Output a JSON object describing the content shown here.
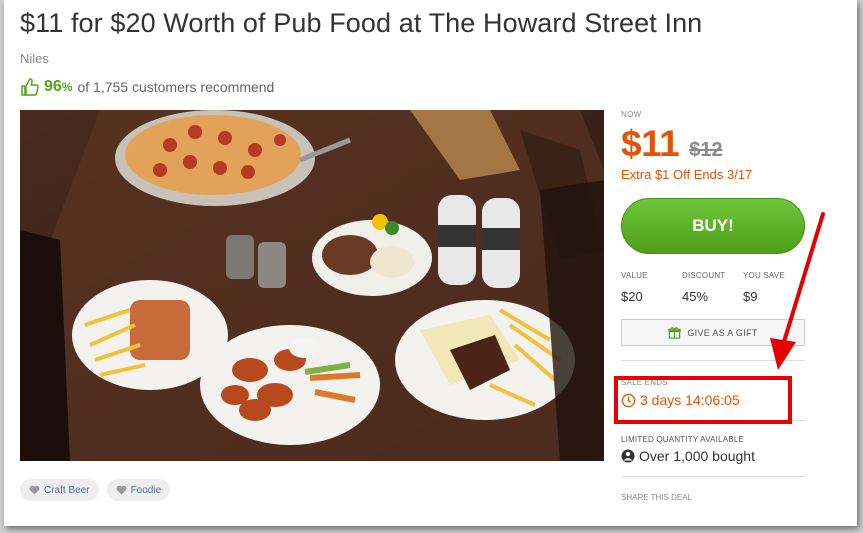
{
  "deal": {
    "title": "$11 for $20 Worth of Pub Food at The Howard Street Inn",
    "location": "Niles",
    "recommend_pct": "96",
    "recommend_pct_sign": "%",
    "recommend_text": "of 1,755 customers recommend"
  },
  "tags": [
    {
      "label": "Craft Beer",
      "icon": "heart-icon"
    },
    {
      "label": "Foodie",
      "icon": "heart-icon"
    }
  ],
  "pricing": {
    "now_label": "NOW",
    "price": "$11",
    "original_price": "$12",
    "promo": "Extra $1 Off Ends 3/17",
    "buy_label": "BUY!",
    "value_label": "VALUE",
    "value": "$20",
    "discount_label": "DISCOUNT",
    "discount": "45%",
    "you_save_label": "YOU SAVE",
    "you_save": "$9",
    "gift_label": "GIVE AS A GIFT"
  },
  "sale": {
    "label": "SALE ENDS",
    "countdown": "3 days 14:06:05"
  },
  "quantity": {
    "label": "LIMITED QUANTITY AVAILABLE",
    "bought": "Over 1,000 bought"
  },
  "share": {
    "label": "SHARE THIS DEAL"
  },
  "colors": {
    "accent_orange": "#e35205",
    "buy_green": "#5fb127",
    "recommend_green": "#53a318",
    "annotation_red": "#e60000",
    "tag_text": "#4a6ea8"
  }
}
